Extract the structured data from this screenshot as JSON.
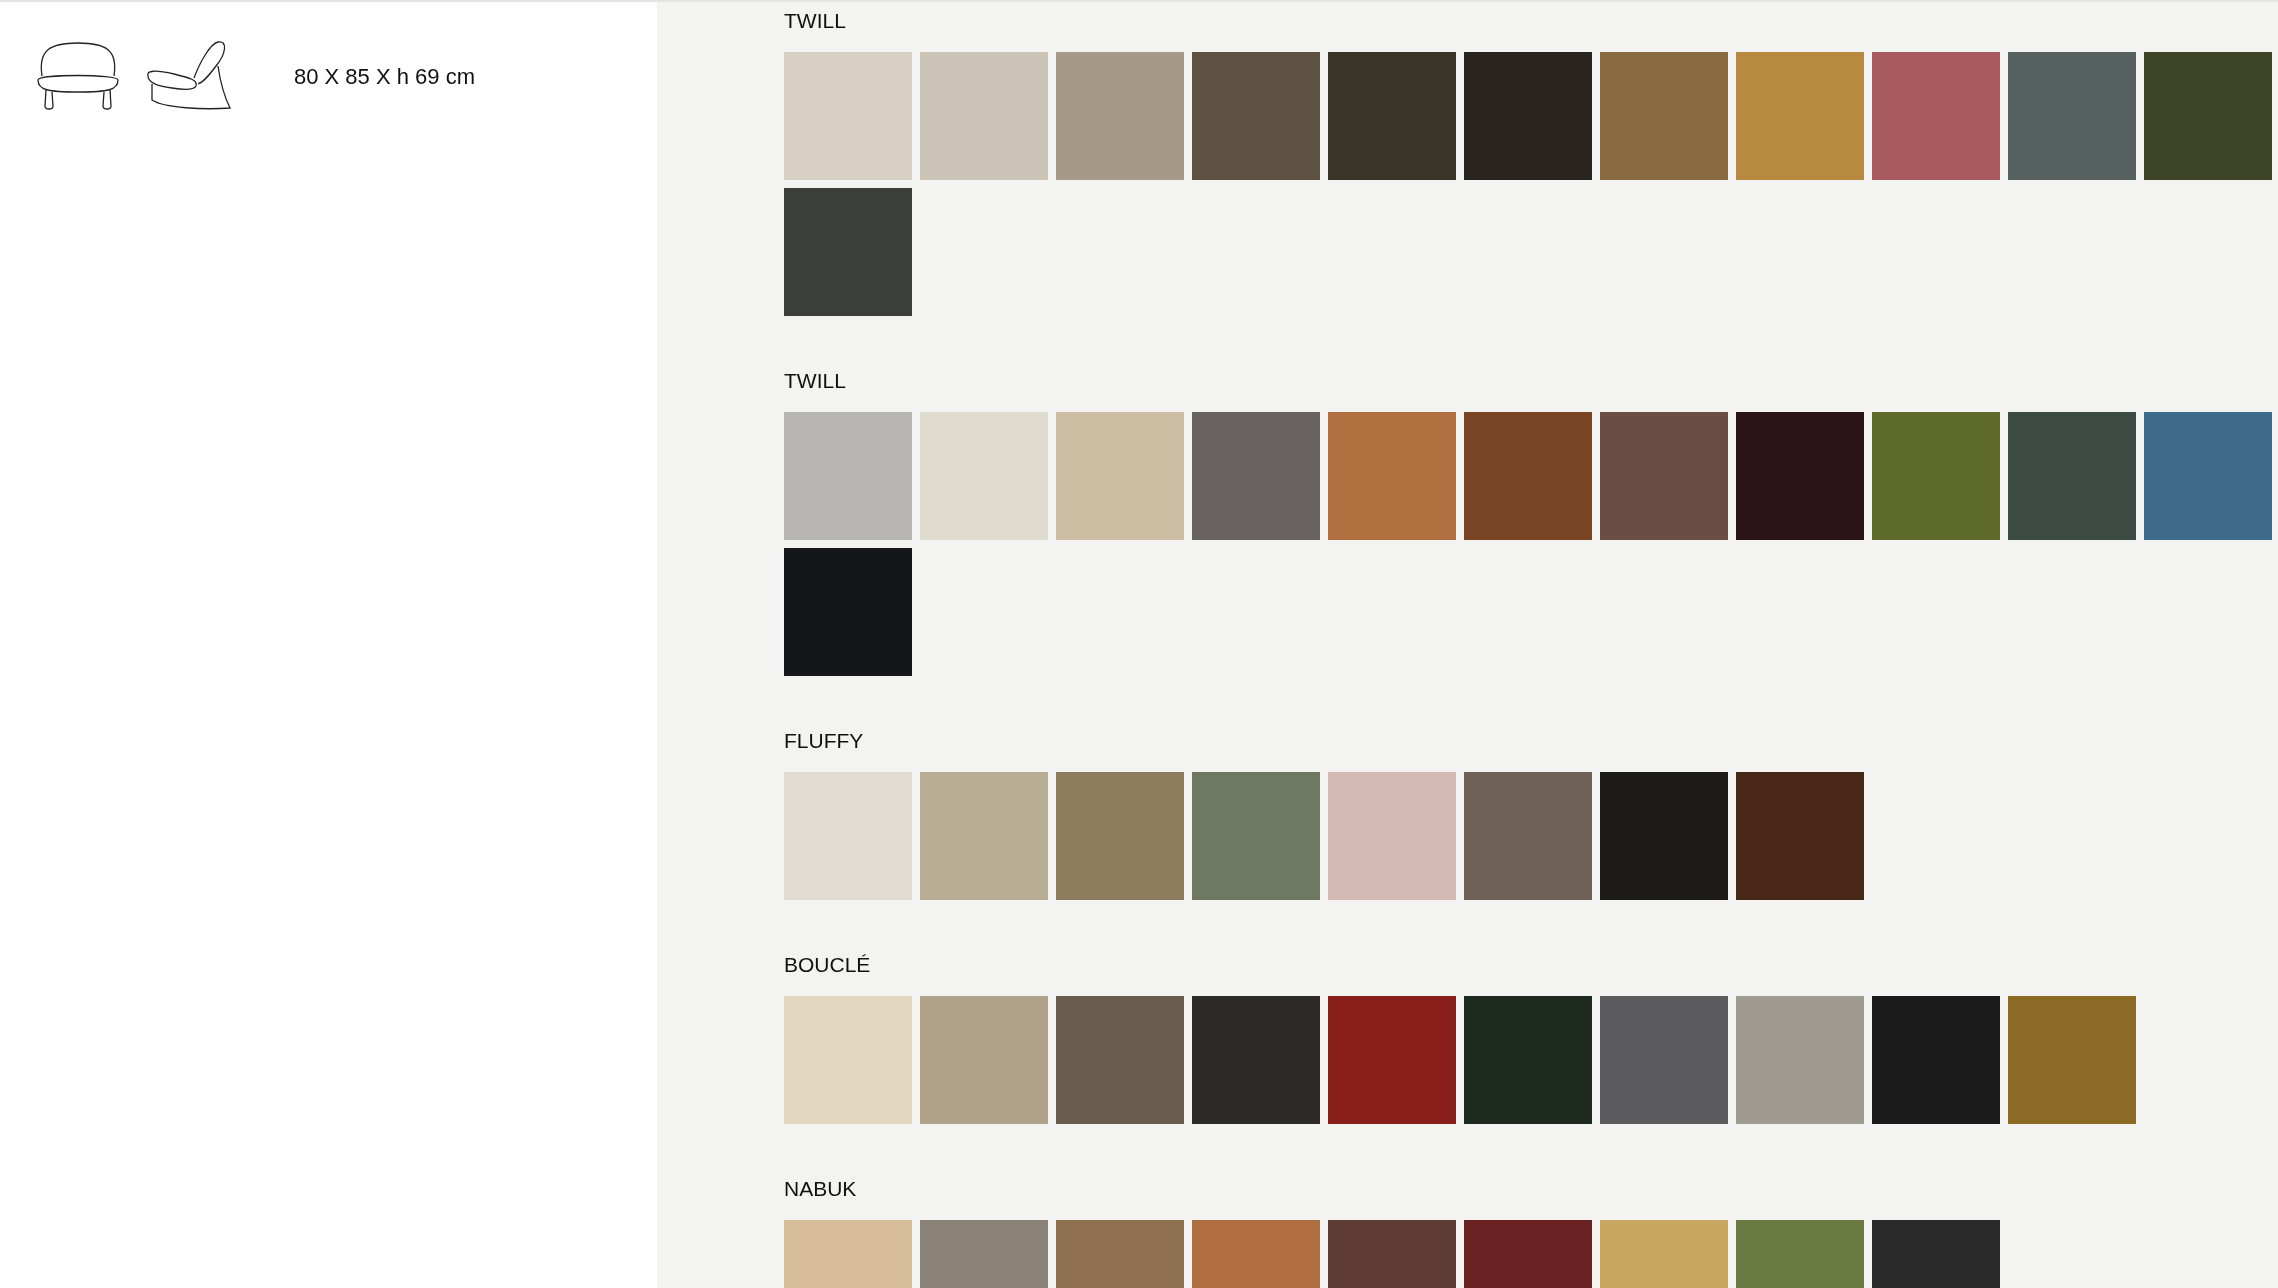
{
  "product": {
    "dimensions": "80 X 85 X h 69 cm"
  },
  "sections": [
    {
      "title": "TWILL",
      "swatches": [
        {
          "color": "#d8d0c4"
        },
        {
          "color": "#cdc4b8"
        },
        {
          "color": "#a59a88"
        },
        {
          "color": "#5e5244"
        },
        {
          "color": "#3a3428"
        },
        {
          "color": "#2b2520"
        },
        {
          "color": "#8a6a40"
        },
        {
          "color": "#b88a40"
        },
        {
          "color": "#a85a5e"
        },
        {
          "color": "#56605e"
        },
        {
          "color": "#3e4428"
        },
        {
          "color": "#3c3e3c"
        }
      ]
    },
    {
      "title": "TWILL",
      "swatches": [
        {
          "color": "#b8b6b4"
        },
        {
          "color": "#e0dace"
        },
        {
          "color": "#cdbda2"
        },
        {
          "color": "#6a6260"
        },
        {
          "color": "#b07040"
        },
        {
          "color": "#7a4524"
        },
        {
          "color": "#6a4e44"
        },
        {
          "color": "#2a1418"
        },
        {
          "color": "#5e6a2a"
        },
        {
          "color": "#3e4a44"
        },
        {
          "color": "#3e6a8a"
        },
        {
          "color": "#14161a"
        }
      ]
    },
    {
      "title": "FLUFFY",
      "swatches": [
        {
          "color": "#e2dcd2"
        },
        {
          "color": "#b8ae94"
        },
        {
          "color": "#8e7c5c"
        },
        {
          "color": "#6e7862"
        },
        {
          "color": "#d4b8b4"
        },
        {
          "color": "#6e6258"
        },
        {
          "color": "#1e1a18"
        },
        {
          "color": "#4a2818"
        }
      ]
    },
    {
      "title": "BOUCLÉ",
      "swatches": [
        {
          "color": "#e2d8c0"
        },
        {
          "color": "#b0a288"
        },
        {
          "color": "#6a5c4c"
        },
        {
          "color": "#2e2a28"
        },
        {
          "color": "#8a1e1a"
        },
        {
          "color": "#1e2a1e"
        },
        {
          "color": "#5c5c5e"
        },
        {
          "color": "#a09a90"
        },
        {
          "color": "#1a1a1a"
        },
        {
          "color": "#8a6a24"
        }
      ]
    },
    {
      "title": "NABUK",
      "swatches": [
        {
          "color": "#d6bc98"
        },
        {
          "color": "#8a8276"
        },
        {
          "color": "#8e7050"
        },
        {
          "color": "#b06e40"
        },
        {
          "color": "#5e3c34"
        },
        {
          "color": "#6a2222"
        },
        {
          "color": "#c8a860"
        },
        {
          "color": "#6a7a40"
        },
        {
          "color": "#2a2a2a"
        }
      ]
    }
  ]
}
